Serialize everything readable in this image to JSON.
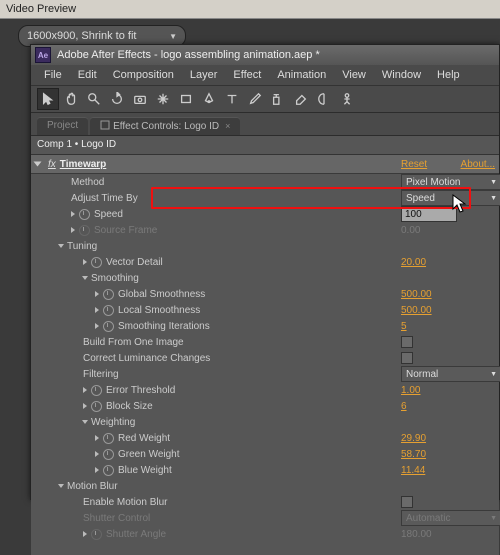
{
  "outer": {
    "title": "Video Preview",
    "resolution": "1600x900, Shrink to fit"
  },
  "app": {
    "title": "Adobe After Effects - logo assembling animation.aep *",
    "menus": [
      "File",
      "Edit",
      "Composition",
      "Layer",
      "Effect",
      "Animation",
      "View",
      "Window",
      "Help"
    ]
  },
  "tabs": {
    "project": "Project",
    "ec": "Effect Controls: Logo ID",
    "close": "×"
  },
  "compbar": "Comp 1 • Logo ID",
  "fx": {
    "name": "Timewarp",
    "reset": "Reset",
    "about": "About...",
    "method": {
      "label": "Method",
      "value": "Pixel Motion"
    },
    "adjust": {
      "label": "Adjust Time By",
      "value": "Speed"
    },
    "speed": {
      "label": "Speed",
      "value": "100"
    },
    "source_frame": {
      "label": "Source Frame",
      "value": "0.00"
    },
    "tuning": "Tuning",
    "vector_detail": {
      "label": "Vector Detail",
      "value": "20.00"
    },
    "smoothing": "Smoothing",
    "global_smooth": {
      "label": "Global Smoothness",
      "value": "500.00"
    },
    "local_smooth": {
      "label": "Local Smoothness",
      "value": "500.00"
    },
    "smooth_iter": {
      "label": "Smoothing Iterations",
      "value": "5"
    },
    "build_from_one": "Build From One Image",
    "correct_lum": "Correct Luminance Changes",
    "filtering": {
      "label": "Filtering",
      "value": "Normal"
    },
    "error_thresh": {
      "label": "Error Threshold",
      "value": "1.00"
    },
    "block_size": {
      "label": "Block Size",
      "value": "6"
    },
    "weighting": "Weighting",
    "red_w": {
      "label": "Red Weight",
      "value": "29.90"
    },
    "green_w": {
      "label": "Green Weight",
      "value": "58.70"
    },
    "blue_w": {
      "label": "Blue Weight",
      "value": "11.44"
    },
    "motion_blur": "Motion Blur",
    "enable_mb": "Enable Motion Blur",
    "shutter_ctrl": {
      "label": "Shutter Control",
      "value": "Automatic"
    },
    "shutter_angle": {
      "label": "Shutter Angle",
      "value": "180.00"
    }
  }
}
